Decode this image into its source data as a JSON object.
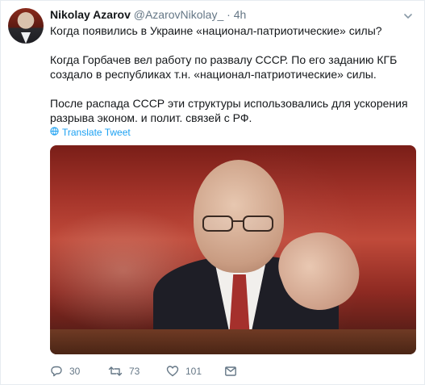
{
  "tweet": {
    "author_name": "Nikolay Azarov",
    "handle": "@AzarovNikolay_",
    "separator": "·",
    "time": "4h",
    "paragraphs": [
      "Когда появились в Украине «национал-патриотические» силы?",
      "Когда Горбачев вел работу по развалу СССР. По его заданию КГБ создало в республиках т.н. «национал-патриотические» силы.",
      "После распада СССР эти структуры использовались для ускорения разрыва эконом. и полит. связей с РФ."
    ],
    "translate_label": "Translate Tweet",
    "counts": {
      "replies": "30",
      "retweets": "73",
      "likes": "101"
    }
  },
  "colors": {
    "text": "#14171a",
    "muted": "#657786",
    "link": "#1da1f2",
    "border": "#e6ecf0"
  },
  "icons": {
    "caret": "chevron-down-icon",
    "translate": "globe-icon",
    "reply": "reply-icon",
    "retweet": "retweet-icon",
    "like": "heart-icon",
    "dm": "envelope-icon"
  }
}
